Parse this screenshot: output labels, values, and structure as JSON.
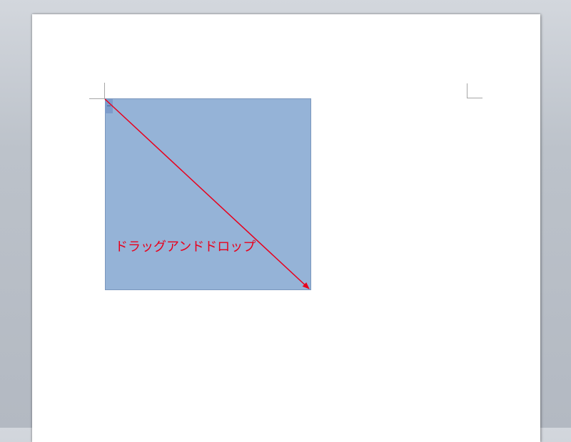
{
  "annotation": {
    "label": "ドラッグアンドドロップ",
    "color": "#e8001c"
  },
  "shape": {
    "fill_color": "#95b3d7",
    "border_color": "#7b97bd"
  },
  "icons": {
    "anchor": "anchor-handle-icon",
    "arrow": "drag-arrow-icon"
  }
}
